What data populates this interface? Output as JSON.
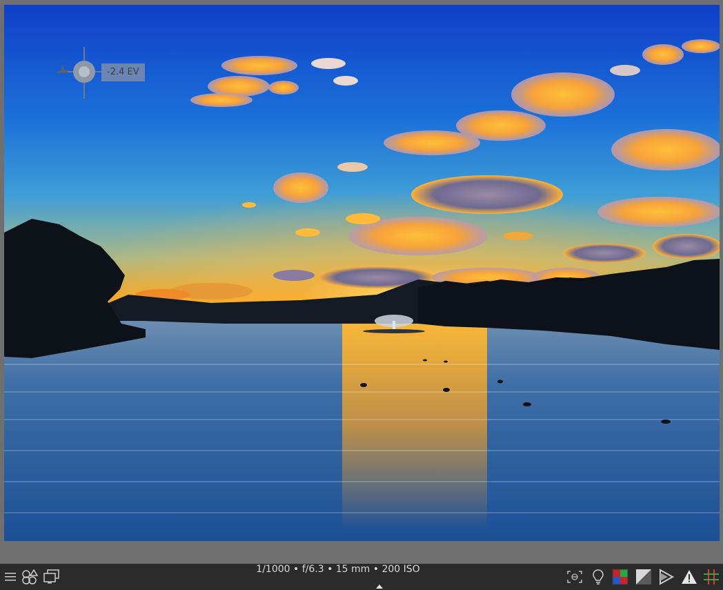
{
  "picker": {
    "ev_value": "-2.4 EV"
  },
  "toolbar": {
    "exif": "1/1000 • f/6.3 • 15 mm • 200 ISO",
    "left_tools": [
      "menu-icon",
      "color-picker-icon",
      "second-monitor-icon"
    ],
    "right_tools": [
      "focus-peaking-icon",
      "lightbulb-icon",
      "color-assessment-icon",
      "softproof-icon",
      "gamut-check-icon",
      "overexposed-warning-icon",
      "guides-icon"
    ]
  },
  "colors": {
    "toolbar_bg": "#2b2b2b",
    "viewport_bg": "#6f6f6f",
    "warning_accent": "#e6e6e6"
  }
}
